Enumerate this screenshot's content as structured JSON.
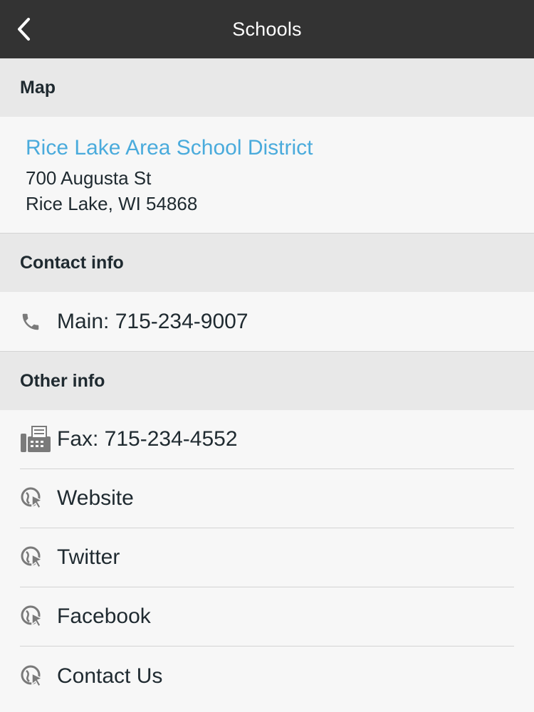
{
  "header": {
    "title": "Schools",
    "back_icon": "chevron-left-icon"
  },
  "map_section": {
    "heading": "Map",
    "district_name": "Rice Lake Area School District",
    "address_line1": "700 Augusta St",
    "address_line2": "Rice Lake, WI 54868"
  },
  "contact_section": {
    "heading": "Contact info",
    "items": [
      {
        "label": "Main: 715-234-9007",
        "icon": "phone-icon"
      }
    ]
  },
  "other_section": {
    "heading": "Other info",
    "items": [
      {
        "label": "Fax: 715-234-4552",
        "icon": "fax-icon"
      },
      {
        "label": "Website",
        "icon": "globe-cursor-icon"
      },
      {
        "label": "Twitter",
        "icon": "globe-cursor-icon"
      },
      {
        "label": "Facebook",
        "icon": "globe-cursor-icon"
      },
      {
        "label": "Contact Us",
        "icon": "globe-cursor-icon"
      }
    ]
  },
  "colors": {
    "nav_bar": "#333333",
    "link": "#4aabdc",
    "section_header_bg": "#e8e8e8",
    "text": "#1f2a30"
  }
}
